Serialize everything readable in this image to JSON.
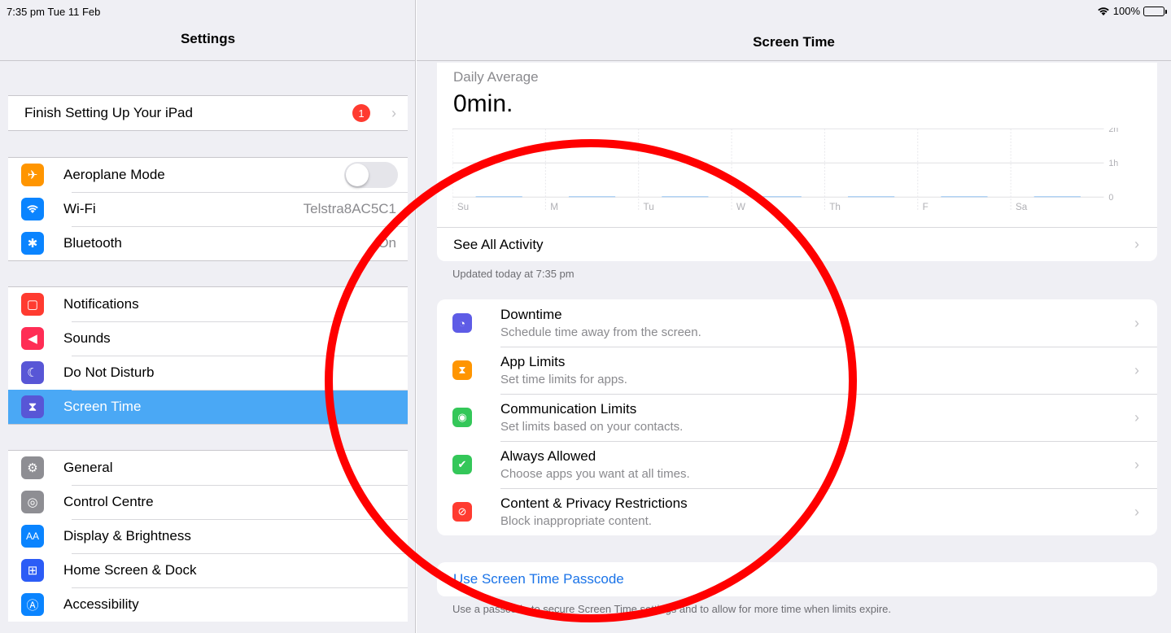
{
  "status": {
    "time": "7:35 pm  Tue 11 Feb",
    "battery": "100%"
  },
  "sidebar": {
    "title": "Settings",
    "finish_setup": {
      "label": "Finish Setting Up Your iPad",
      "badge": "1"
    },
    "connectivity": [
      {
        "label": "Aeroplane Mode",
        "icon": "airplane-icon",
        "color": "#ff9500"
      },
      {
        "label": "Wi-Fi",
        "value": "Telstra8AC5C1",
        "icon": "wifi-icon",
        "color": "#0a84ff"
      },
      {
        "label": "Bluetooth",
        "value": "On",
        "icon": "bluetooth-icon",
        "color": "#0a84ff"
      }
    ],
    "notifications": [
      {
        "label": "Notifications",
        "icon": "notifications-icon",
        "color": "#ff3b30"
      },
      {
        "label": "Sounds",
        "icon": "speaker-icon",
        "color": "#ff2d55"
      },
      {
        "label": "Do Not Disturb",
        "icon": "moon-icon",
        "color": "#5856d6"
      },
      {
        "label": "Screen Time",
        "icon": "hourglass-icon",
        "color": "#5856d6"
      }
    ],
    "general": [
      {
        "label": "General",
        "icon": "gear-icon",
        "color": "#8e8e93"
      },
      {
        "label": "Control Centre",
        "icon": "switches-icon",
        "color": "#8e8e93"
      },
      {
        "label": "Display & Brightness",
        "icon": "text-size-icon",
        "color": "#0a84ff"
      },
      {
        "label": "Home Screen & Dock",
        "icon": "grid-icon",
        "color": "#2c5cf6"
      },
      {
        "label": "Accessibility",
        "icon": "accessibility-icon",
        "color": "#0a84ff"
      }
    ]
  },
  "main": {
    "title": "Screen Time",
    "daily_label": "Daily Average",
    "daily_value": "0min.",
    "see_all": "See All Activity",
    "updated": "Updated today at 7:35 pm",
    "limits": [
      {
        "title": "Downtime",
        "sub": "Schedule time away from the screen.",
        "icon": "downtime-icon",
        "color": "#5e5ce6"
      },
      {
        "title": "App Limits",
        "sub": "Set time limits for apps.",
        "icon": "hourglass-icon",
        "color": "#ff9500"
      },
      {
        "title": "Communication Limits",
        "sub": "Set limits based on your contacts.",
        "icon": "contact-icon",
        "color": "#34c759"
      },
      {
        "title": "Always Allowed",
        "sub": "Choose apps you want at all times.",
        "icon": "checkmark-icon",
        "color": "#34c759"
      },
      {
        "title": "Content & Privacy Restrictions",
        "sub": "Block inappropriate content.",
        "icon": "restriction-icon",
        "color": "#ff3b30"
      }
    ],
    "passcode_link": "Use Screen Time Passcode",
    "passcode_note": "Use a passcode to secure Screen Time settings and to allow for more time when limits expire."
  },
  "chart_data": {
    "type": "bar",
    "categories": [
      "Su",
      "M",
      "Tu",
      "W",
      "Th",
      "F",
      "Sa"
    ],
    "values": [
      0,
      0,
      0,
      0,
      0,
      0,
      0
    ],
    "y_ticks": [
      "2h",
      "1h",
      "0"
    ],
    "ylim": [
      0,
      2
    ],
    "grid": true
  },
  "annotation": {
    "shape": "circle",
    "color": "#ff0000"
  }
}
